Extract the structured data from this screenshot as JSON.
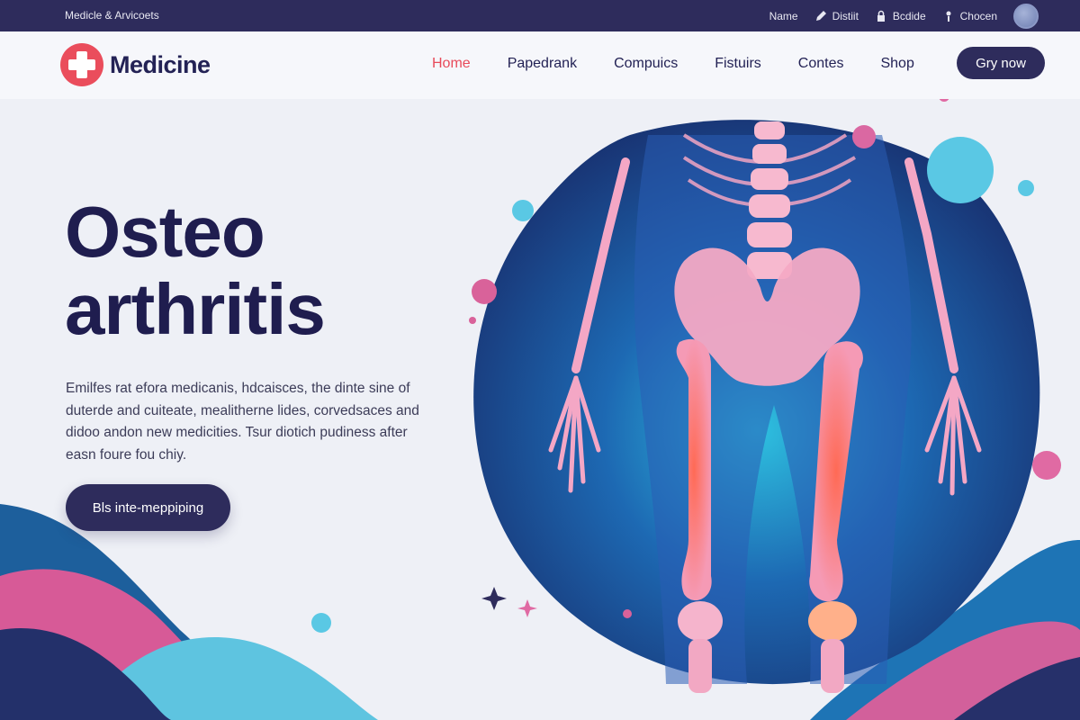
{
  "topbar": {
    "brand_line": "Medicle & Arvicoets",
    "links": [
      {
        "label": "Name",
        "icon": "none"
      },
      {
        "label": "Distiit",
        "icon": "pencil-icon"
      },
      {
        "label": "Bcdide",
        "icon": "lock-icon"
      },
      {
        "label": "Chocen",
        "icon": "info-icon"
      }
    ],
    "avatar": "avatar"
  },
  "header": {
    "logo_text": "Medicine",
    "nav": [
      {
        "label": "Home",
        "active": true
      },
      {
        "label": "Papedrank",
        "active": false
      },
      {
        "label": "Compuics",
        "active": false
      },
      {
        "label": "Fistuirs",
        "active": false
      },
      {
        "label": "Contes",
        "active": false
      },
      {
        "label": "Shop",
        "active": false
      }
    ],
    "cta_label": "Gry now"
  },
  "hero": {
    "title_line1": "Osteo",
    "title_line2": "arthritis",
    "description": "Emilfes rat efora medicanis, hdcaisces, the dinte sine of duterde and cuiteate, mealitherne lides, corvedsaces and didoo andon new medicities.   Tsur diotich pudiness after easn foure fou chiy.",
    "button_label": "Bls inte-meppiping"
  },
  "colors": {
    "navy": "#2e2c5c",
    "accent_red": "#e84a5a",
    "pink": "#d9629a",
    "cyan": "#4fc3df",
    "blue": "#1e6fae"
  }
}
